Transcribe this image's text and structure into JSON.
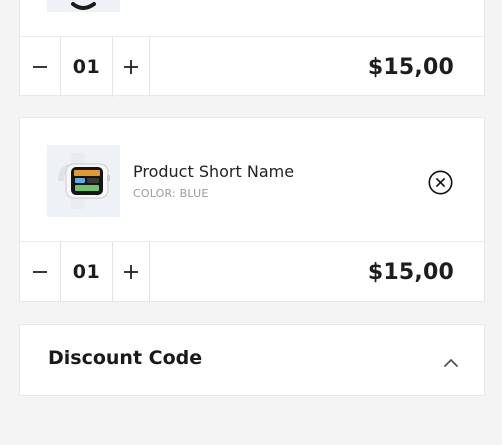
{
  "cart": {
    "items": [
      {
        "quantity": "01",
        "price": "$15,00"
      },
      {
        "name": "Product Short Name",
        "color": "COLOR: BLUE",
        "quantity": "01",
        "price": "$15,00"
      }
    ]
  },
  "discount": {
    "title": "Discount Code"
  },
  "icons": {
    "decrease": "minus-icon",
    "increase": "plus-icon",
    "remove": "close-circle-icon",
    "toggle": "chevron-up-icon"
  },
  "colors": {
    "background": "#f4f4f4",
    "card": "#ffffff",
    "text": "#1d1d1d",
    "muted": "#9a9a9a"
  }
}
